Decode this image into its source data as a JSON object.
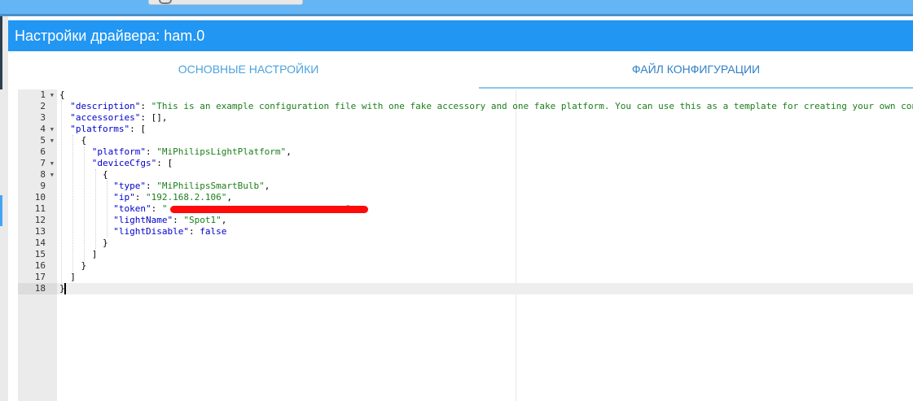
{
  "dialog": {
    "title": "Настройки драйвера: ham.0",
    "tabs": [
      {
        "label": "ОСНОВНЫЕ НАСТРОЙКИ",
        "active": false
      },
      {
        "label": "ФАЙЛ КОНФИГУРАЦИИ",
        "active": true
      }
    ]
  },
  "editor": {
    "active_line": 18,
    "lines": [
      {
        "n": "1",
        "fold": true
      },
      {
        "n": "2",
        "fold": false
      },
      {
        "n": "3",
        "fold": false
      },
      {
        "n": "4",
        "fold": true
      },
      {
        "n": "5",
        "fold": true
      },
      {
        "n": "6",
        "fold": false
      },
      {
        "n": "7",
        "fold": true
      },
      {
        "n": "8",
        "fold": true
      },
      {
        "n": "9",
        "fold": false
      },
      {
        "n": "10",
        "fold": false
      },
      {
        "n": "11",
        "fold": false
      },
      {
        "n": "12",
        "fold": false
      },
      {
        "n": "13",
        "fold": false
      },
      {
        "n": "14",
        "fold": false
      },
      {
        "n": "15",
        "fold": false
      },
      {
        "n": "16",
        "fold": false
      },
      {
        "n": "17",
        "fold": false
      },
      {
        "n": "18",
        "fold": false
      }
    ],
    "code": {
      "l1_brace": "{",
      "l2_key": "\"description\"",
      "l2_val": "\"This is an example configuration file with one fake accessory and one fake platform. You can use this as a template for creating your own configuration file\"",
      "l3_key": "\"accessories\"",
      "l3_val": "[],",
      "l4_key": "\"platforms\"",
      "l4_val": "[",
      "l5": "{",
      "l6_key": "\"platform\"",
      "l6_val": "\"MiPhilipsLightPlatform\"",
      "l7_key": "\"deviceCfgs\"",
      "l7_val": "[",
      "l8": "{",
      "l9_key": "\"type\"",
      "l9_val": "\"MiPhilipsSmartBulb\"",
      "l10_key": "\"ip\"",
      "l10_val": "\"192.168.2.106\"",
      "l11_key": "\"token\"",
      "l11_val_open": "\"",
      "l11_val_close": "\"",
      "l12_key": "\"lightName\"",
      "l12_val": "\"Spot1\"",
      "l13_key": "\"lightDisable\"",
      "l13_val": "false",
      "l14": "}",
      "l15": "]",
      "l16": "}",
      "l17": "]",
      "l18": "}"
    },
    "redaction_color": "#ff0a0a"
  }
}
